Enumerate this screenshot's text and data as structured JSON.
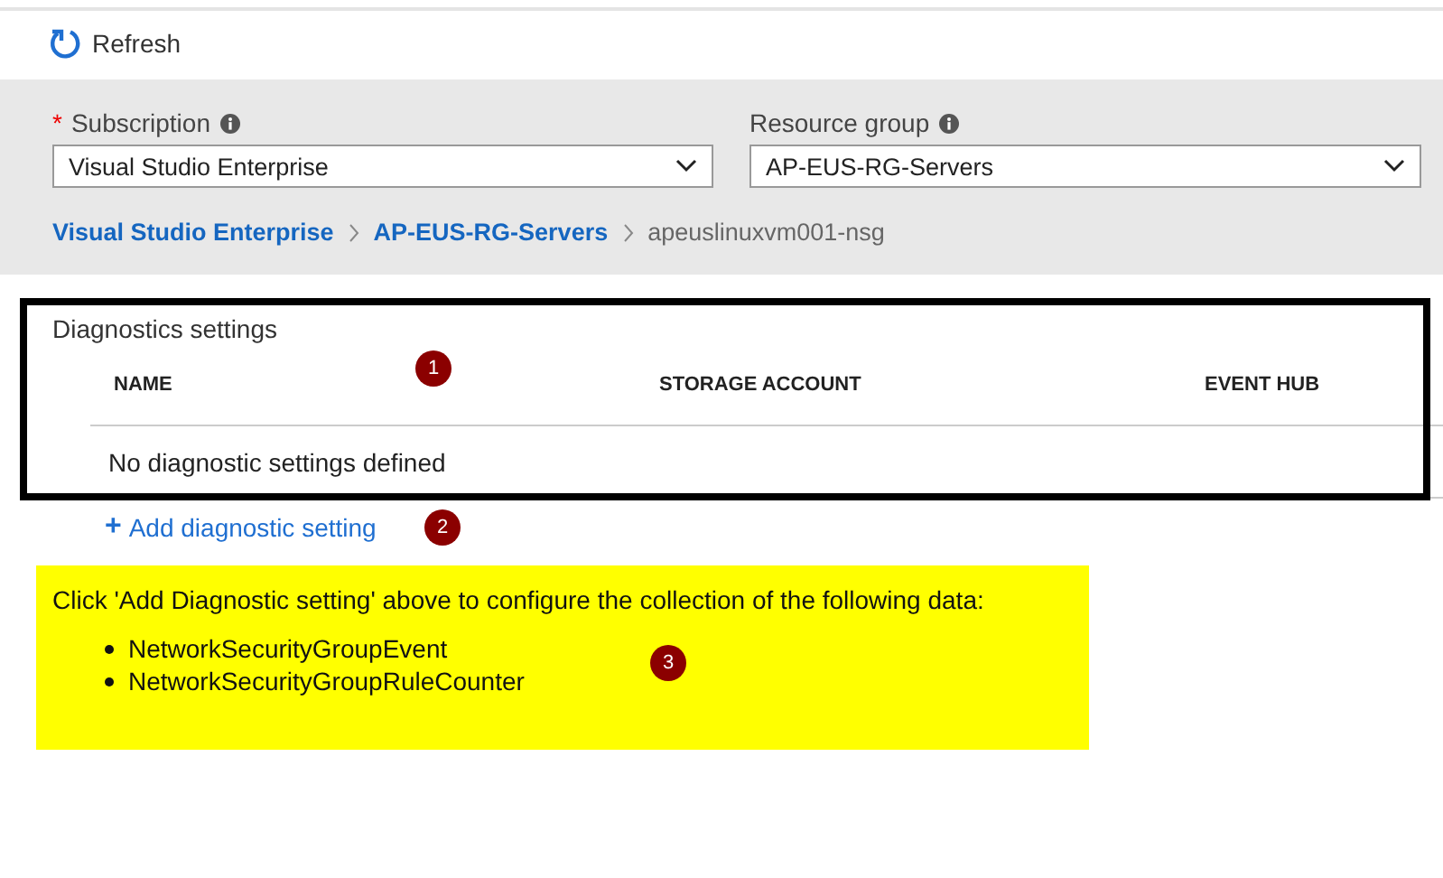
{
  "toolbar": {
    "refresh": "Refresh"
  },
  "filters": [
    {
      "required_mark": "*",
      "label": "Subscription",
      "value": "Visual Studio Enterprise"
    },
    {
      "label": "Resource group",
      "value": "AP-EUS-RG-Servers"
    }
  ],
  "breadcrumb": [
    {
      "label": "Visual Studio Enterprise",
      "kind": "link"
    },
    {
      "label": "AP-EUS-RG-Servers",
      "kind": "link"
    },
    {
      "label": "apeuslinuxvm001-nsg",
      "kind": "current"
    }
  ],
  "diagnostics": {
    "title": "Diagnostics settings",
    "marker": "1",
    "columns": [
      "NAME",
      "STORAGE ACCOUNT",
      "EVENT HUB"
    ],
    "empty_text": "No diagnostic settings defined"
  },
  "add_setting": {
    "icon": "+",
    "label": "Add diagnostic setting",
    "marker": "2"
  },
  "note": {
    "text": "Click 'Add Diagnostic setting' above to configure the collection of the following data:",
    "items": [
      "NetworkSecurityGroupEvent",
      "NetworkSecurityGroupRuleCounter"
    ],
    "marker": "3"
  }
}
